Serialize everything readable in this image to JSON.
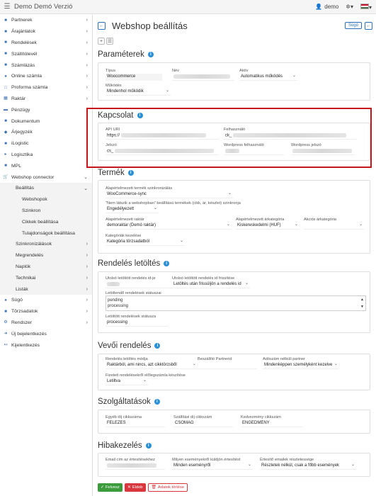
{
  "app": {
    "title": "Demo Demó Verzió",
    "user": "demo"
  },
  "sidebar": {
    "items": [
      {
        "label": "Partnerek",
        "icon": "book-icon"
      },
      {
        "label": "Árajánlatok",
        "icon": "tag-icon"
      },
      {
        "label": "Rendelések",
        "icon": "order-icon"
      },
      {
        "label": "Szállítólevél",
        "icon": "truck-icon"
      },
      {
        "label": "Számlázás",
        "icon": "invoice-icon"
      },
      {
        "label": "Online számla",
        "icon": "globe-icon"
      },
      {
        "label": "Proforma számla",
        "icon": "file-icon"
      },
      {
        "label": "Raktár",
        "icon": "warehouse-icon"
      },
      {
        "label": "Pénzügy",
        "icon": "money-icon"
      },
      {
        "label": "Dokumentum",
        "icon": "document-icon"
      },
      {
        "label": "Árjegyzék",
        "icon": "pricelist-icon"
      },
      {
        "label": "iLogistic",
        "icon": "logistic-icon"
      },
      {
        "label": "Logisztika",
        "icon": "logistics-icon"
      },
      {
        "label": "MPL",
        "icon": "mpl-icon"
      },
      {
        "label": "Webshop connector",
        "icon": "cart-icon"
      }
    ],
    "sub": [
      "Beállítás",
      "Webshopok",
      "Szinkron",
      "Cikkek beállítása",
      "Tulajdonságok beállítása",
      "Szinkronizálások",
      "Megrendelés",
      "Naplók",
      "Technikai",
      "Listák"
    ],
    "bottom": [
      {
        "label": "Súgó",
        "icon": "help-icon"
      },
      {
        "label": "Törzsadatok",
        "icon": "database-icon"
      },
      {
        "label": "Rendszer",
        "icon": "gears-icon"
      },
      {
        "label": "Új bejelentkezés",
        "icon": "login-icon"
      },
      {
        "label": "Kijelentkezés",
        "icon": "logout-icon"
      }
    ]
  },
  "page": {
    "title": "Webshop beállítás",
    "help": "Súgó"
  },
  "params": {
    "title": "Paraméterek",
    "type_label": "Típus",
    "type_value": "Woocommerce",
    "name_label": "Név",
    "active_label": "Aktív",
    "active_value": "Automatikus működés",
    "mode_label": "Működés",
    "mode_value": "Mindenhol működik"
  },
  "conn": {
    "title": "Kapcsolat",
    "api_label": "API URI",
    "api_value": "https://",
    "user_label": "Felhasználó",
    "user_value": "ck_",
    "pass_label": "Jelszó",
    "pass_value": "cs_",
    "wpuser_label": "Wordpress felhasználó",
    "wppass_label": "Wordpress jelszó"
  },
  "product": {
    "title": "Termék",
    "sync_label": "Alapértelmezett termék szinkronizálás",
    "sync_value": "WooCommerce-sync",
    "notinshop_label": "\"Nem látszik a webshopban\" beállítású termékek (cikk, ár, készlet) szinkronja",
    "notinshop_value": "Engedélyezett",
    "warehouse_label": "Alapértelmezett raktár",
    "warehouse_value": "demoraktar (Demó raktár)",
    "pricecat_label": "Alapértelmezett árkategória",
    "pricecat_value": "Kiskereskedelmi (HUF)",
    "salecat_label": "Akciós árkategória",
    "catmgmt_label": "Kategóriák kezelése",
    "catmgmt_value": "Kategória törzsadatból"
  },
  "orders": {
    "title": "Rendelés letöltés",
    "lastid_label": "Utolsó letöltött rendelés id-je",
    "refresh_label": "Utolsó letöltött rendelés id frissítése",
    "refresh_value": "Letöltés után frissüljön a rendelés id",
    "statuses_label": "Letöltendő rendelések státuszai",
    "statuses": [
      "pending",
      "processing"
    ],
    "downloaded_label": "Letöltött rendelések státusza",
    "downloaded_value": "processing"
  },
  "customer": {
    "title": "Vevői rendelés",
    "mode_label": "Rendelés letöltés módja",
    "mode_value": "Raktárból, ami nincs, azt cikktörzsből",
    "supplier_label": "Beszállító Partnerid",
    "taxfree_label": "Adószám nélküli partner",
    "taxfree_value": "Mindenképpen személyként kezelve",
    "prepay_label": "Fizetett rendelésekről előlegszámla készítése",
    "prepay_value": "Letiltva"
  },
  "services": {
    "title": "Szolgáltatások",
    "fee_label": "Egyéb díj cikkszáma",
    "fee_value": "FELEZES",
    "ship_label": "Szállítási díj cikkszám",
    "ship_value": "CSOMAG",
    "disc_label": "Kedvezmény cikkszám",
    "disc_value": "ENGEDMÉNY"
  },
  "errors": {
    "title": "Hibakezelés",
    "email_label": "Email cím az értesítésekhez",
    "events_label": "Milyen eseményekről küldjön értesítést",
    "events_value": "Minden eseményről",
    "detail_label": "Értesítő emailek részletessége",
    "detail_value": "Részletek nélkül, csak a főbb események"
  },
  "actions": {
    "save": "Felvesz",
    "cancel": "Eldob",
    "delete": "Adatok törlése"
  }
}
